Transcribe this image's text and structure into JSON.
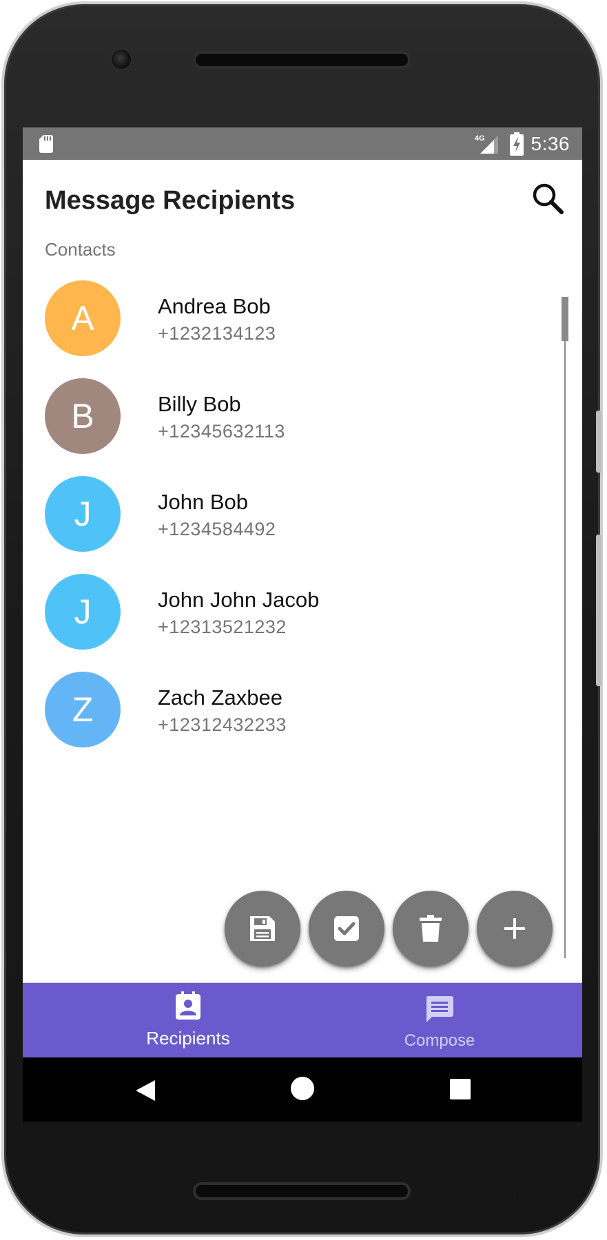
{
  "status_bar": {
    "time": "5:36",
    "network": "4G",
    "icons": [
      "sd-card-icon",
      "signal-4g-icon",
      "battery-charging-icon"
    ]
  },
  "app_bar": {
    "title": "Message Recipients",
    "search_icon": "search-icon"
  },
  "section_label": "Contacts",
  "contacts": [
    {
      "initial": "A",
      "name": "Andrea Bob",
      "phone": "+1232134123",
      "color": "#ffb74d"
    },
    {
      "initial": "B",
      "name": "Billy Bob",
      "phone": "+12345632113",
      "color": "#a1887f"
    },
    {
      "initial": "J",
      "name": "John Bob",
      "phone": "+1234584492",
      "color": "#4fc3f7"
    },
    {
      "initial": "J",
      "name": "John John Jacob",
      "phone": "+12313521232",
      "color": "#4fc3f7"
    },
    {
      "initial": "Z",
      "name": "Zach Zaxbee",
      "phone": "+12312432233",
      "color": "#64b5f6"
    }
  ],
  "fabs": [
    {
      "icon": "save-icon"
    },
    {
      "icon": "check-icon"
    },
    {
      "icon": "delete-icon"
    },
    {
      "icon": "add-icon"
    }
  ],
  "bottom_nav": {
    "items": [
      {
        "label": "Recipients",
        "icon": "contacts-icon",
        "active": true
      },
      {
        "label": "Compose",
        "icon": "message-icon",
        "active": false
      }
    ],
    "background": "#6a5acd"
  },
  "system_nav": [
    "back-icon",
    "home-icon",
    "recents-icon"
  ]
}
